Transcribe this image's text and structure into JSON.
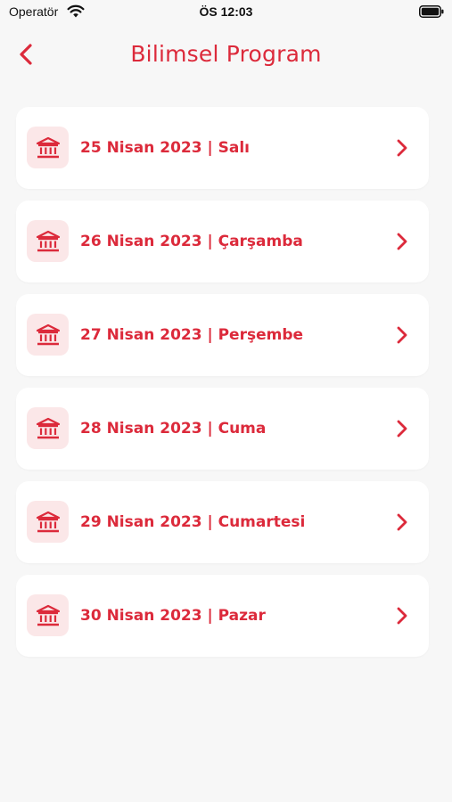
{
  "status_bar": {
    "carrier": "Operatör",
    "time": "ÖS 12:03"
  },
  "header": {
    "title": "Bilimsel Program",
    "back_icon": "chevron-left-icon"
  },
  "colors": {
    "accent": "#dc2a3b",
    "icon_bg": "#fbe7e8",
    "background": "#f7f7f7",
    "card_bg": "#ffffff"
  },
  "days": [
    {
      "label": "25 Nisan 2023 | Salı",
      "icon": "institution-icon"
    },
    {
      "label": "26 Nisan 2023 | Çarşamba",
      "icon": "institution-icon"
    },
    {
      "label": "27 Nisan 2023 | Perşembe",
      "icon": "institution-icon"
    },
    {
      "label": "28 Nisan 2023 | Cuma",
      "icon": "institution-icon"
    },
    {
      "label": "29 Nisan 2023 | Cumartesi",
      "icon": "institution-icon"
    },
    {
      "label": "30 Nisan 2023 | Pazar",
      "icon": "institution-icon"
    }
  ]
}
